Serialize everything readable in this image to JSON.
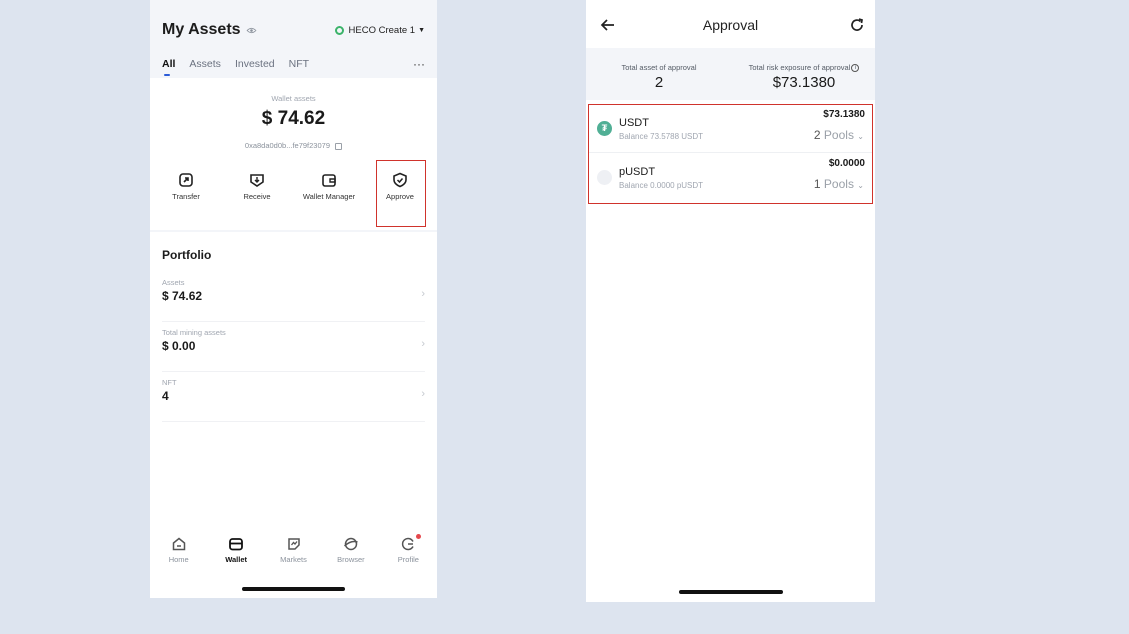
{
  "left": {
    "title": "My Assets",
    "network": "HECO Create 1",
    "tabs": [
      "All",
      "Assets",
      "Invested",
      "NFT"
    ],
    "wallet": {
      "label": "Wallet assets",
      "value": "$ 74.62",
      "address": "0xa8da0d0b...fe79f23079"
    },
    "actions": [
      "Transfer",
      "Receive",
      "Wallet Manager",
      "Approve"
    ],
    "portfolio": {
      "title": "Portfolio",
      "rows": [
        {
          "label": "Assets",
          "value": "$ 74.62"
        },
        {
          "label": "Total mining assets",
          "value": "$ 0.00"
        },
        {
          "label": "NFT",
          "value": "4"
        }
      ]
    },
    "nav": [
      "Home",
      "Wallet",
      "Markets",
      "Browser",
      "Profile"
    ]
  },
  "right": {
    "title": "Approval",
    "summary": {
      "total_asset_label": "Total asset of approval",
      "total_asset_value": "2",
      "risk_label": "Total risk exposure of approval",
      "risk_value": "$73.1380"
    },
    "tokens": [
      {
        "name": "USDT",
        "balance": "Balance 73.5788 USDT",
        "value": "$73.1380",
        "pool_count": "2",
        "pool_suffix": "Pools"
      },
      {
        "name": "pUSDT",
        "balance": "Balance 0.0000 pUSDT",
        "value": "$0.0000",
        "pool_count": "1",
        "pool_suffix": "Pools"
      }
    ]
  },
  "colors": {
    "accent_blue": "#2b5bd7",
    "highlight_red": "#d0332c",
    "usdt_green": "#50af95",
    "network_green": "#3bb36a"
  }
}
